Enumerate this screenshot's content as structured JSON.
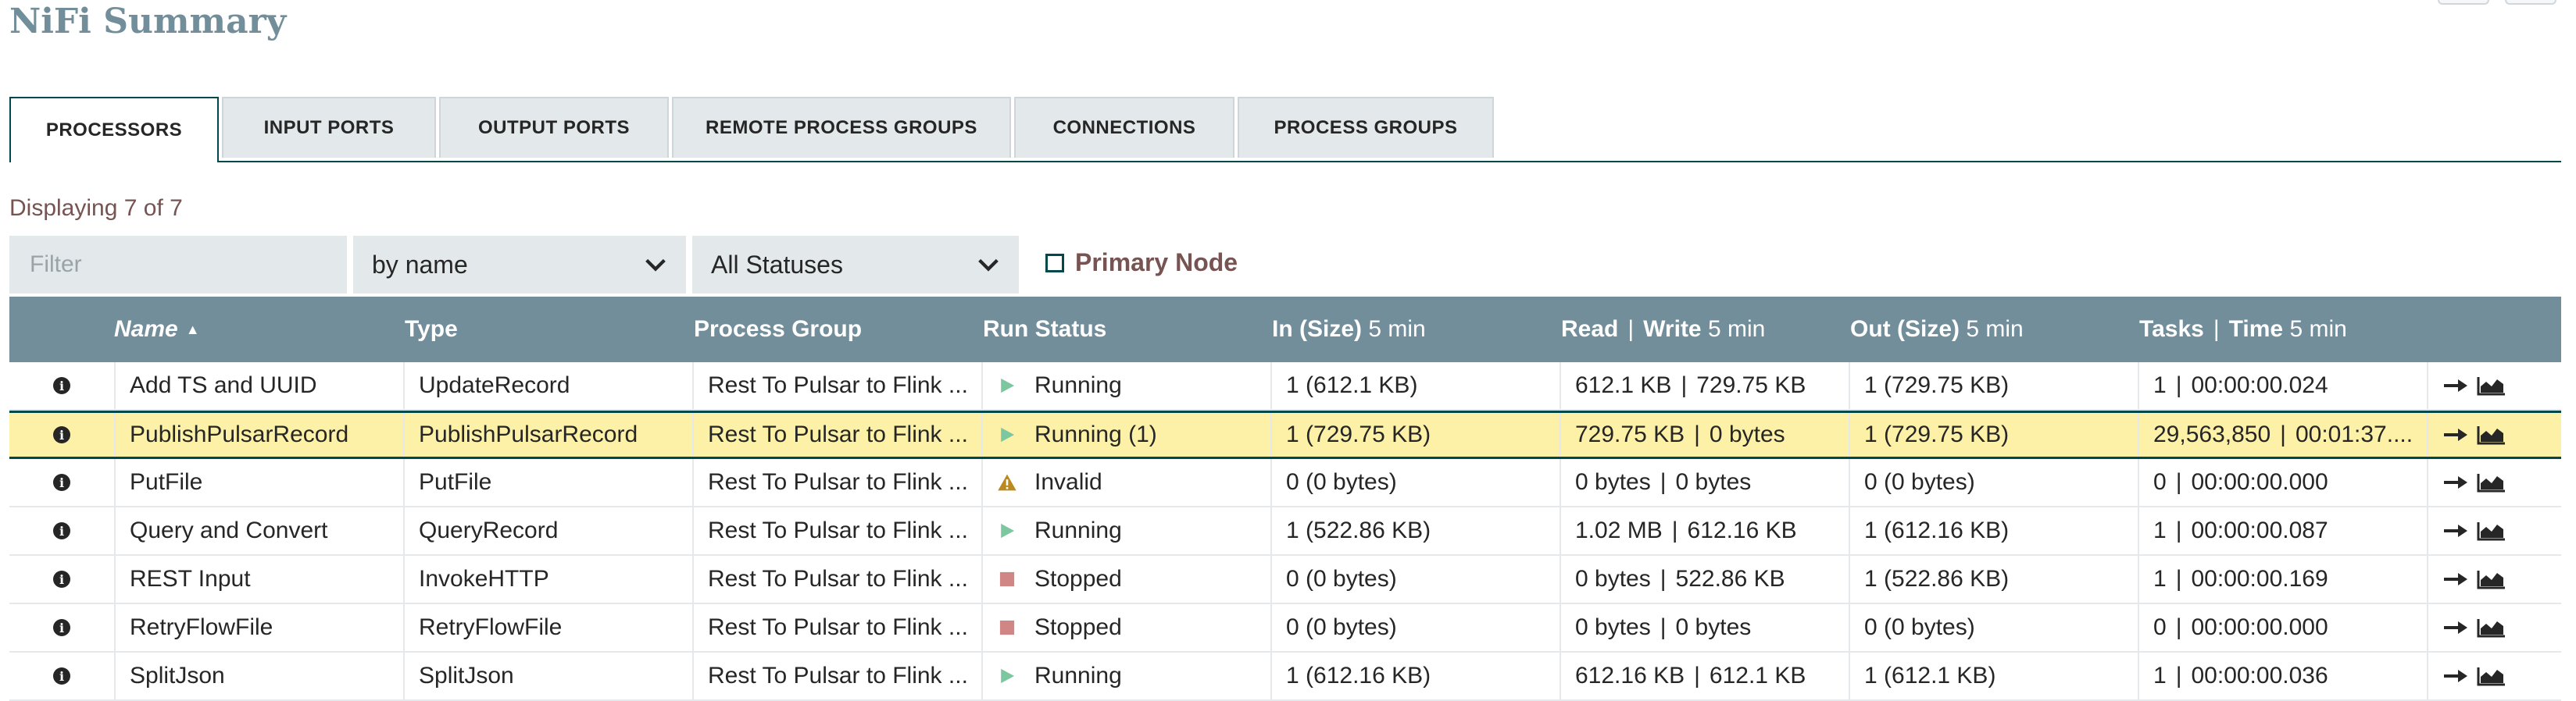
{
  "page": {
    "title": "NiFi Summary"
  },
  "tabs": [
    {
      "label": "PROCESSORS",
      "active": true
    },
    {
      "label": "INPUT PORTS",
      "active": false
    },
    {
      "label": "OUTPUT PORTS",
      "active": false
    },
    {
      "label": "REMOTE PROCESS GROUPS",
      "active": false
    },
    {
      "label": "CONNECTIONS",
      "active": false
    },
    {
      "label": "PROCESS GROUPS",
      "active": false
    }
  ],
  "toolbar": {
    "displaying": "Displaying 7 of 7",
    "filter_placeholder": "Filter",
    "filter_by": "by name",
    "status_filter": "All Statuses",
    "primary_node_label": "Primary Node",
    "primary_node_checked": false
  },
  "columns": {
    "name": "Name",
    "type": "Type",
    "process_group": "Process Group",
    "run_status": "Run Status",
    "in": "In (Size)",
    "in_window": "5 min",
    "read": "Read",
    "write": "Write",
    "rw_window": "5 min",
    "out": "Out (Size)",
    "out_window": "5 min",
    "tasks": "Tasks",
    "time": "Time",
    "tasks_window": "5 min"
  },
  "colors": {
    "header_bg": "#728e9b",
    "running": "#7dc7a0",
    "stopped": "#d18686",
    "invalid": "#ba8a1f",
    "selected_row": "#fcf1a7"
  },
  "rows": [
    {
      "name": "Add TS and UUID",
      "type": "UpdateRecord",
      "group": "Rest To Pulsar to Flink ...",
      "status": "Running",
      "status_kind": "running",
      "in": "1 (612.1 KB)",
      "read": "612.1 KB",
      "write": "729.75 KB",
      "out": "1 (729.75 KB)",
      "tasks": "1",
      "time": "00:00:00.024",
      "selected": false
    },
    {
      "name": "PublishPulsarRecord",
      "type": "PublishPulsarRecord",
      "group": "Rest To Pulsar to Flink ...",
      "status": "Running (1)",
      "status_kind": "running",
      "in": "1 (729.75 KB)",
      "read": "729.75 KB",
      "write": "0 bytes",
      "out": "1 (729.75 KB)",
      "tasks": "29,563,850",
      "time": "00:01:37....",
      "selected": true
    },
    {
      "name": "PutFile",
      "type": "PutFile",
      "group": "Rest To Pulsar to Flink ...",
      "status": "Invalid",
      "status_kind": "invalid",
      "in": "0 (0 bytes)",
      "read": "0 bytes",
      "write": "0 bytes",
      "out": "0 (0 bytes)",
      "tasks": "0",
      "time": "00:00:00.000",
      "selected": false
    },
    {
      "name": "Query and Convert",
      "type": "QueryRecord",
      "group": "Rest To Pulsar to Flink ...",
      "status": "Running",
      "status_kind": "running",
      "in": "1 (522.86 KB)",
      "read": "1.02 MB",
      "write": "612.16 KB",
      "out": "1 (612.16 KB)",
      "tasks": "1",
      "time": "00:00:00.087",
      "selected": false
    },
    {
      "name": "REST Input",
      "type": "InvokeHTTP",
      "group": "Rest To Pulsar to Flink ...",
      "status": "Stopped",
      "status_kind": "stopped",
      "in": "0 (0 bytes)",
      "read": "0 bytes",
      "write": "522.86 KB",
      "out": "1 (522.86 KB)",
      "tasks": "1",
      "time": "00:00:00.169",
      "selected": false
    },
    {
      "name": "RetryFlowFile",
      "type": "RetryFlowFile",
      "group": "Rest To Pulsar to Flink ...",
      "status": "Stopped",
      "status_kind": "stopped",
      "in": "0 (0 bytes)",
      "read": "0 bytes",
      "write": "0 bytes",
      "out": "0 (0 bytes)",
      "tasks": "0",
      "time": "00:00:00.000",
      "selected": false
    },
    {
      "name": "SplitJson",
      "type": "SplitJson",
      "group": "Rest To Pulsar to Flink ...",
      "status": "Running",
      "status_kind": "running",
      "in": "1 (612.16 KB)",
      "read": "612.16 KB",
      "write": "612.1 KB",
      "out": "1 (612.1 KB)",
      "tasks": "1",
      "time": "00:00:00.036",
      "selected": false
    }
  ],
  "icons": {
    "row_info": "info-icon",
    "go_to": "arrow-right-icon",
    "status_history": "area-chart-icon",
    "dropdown": "chevron-down-icon"
  }
}
